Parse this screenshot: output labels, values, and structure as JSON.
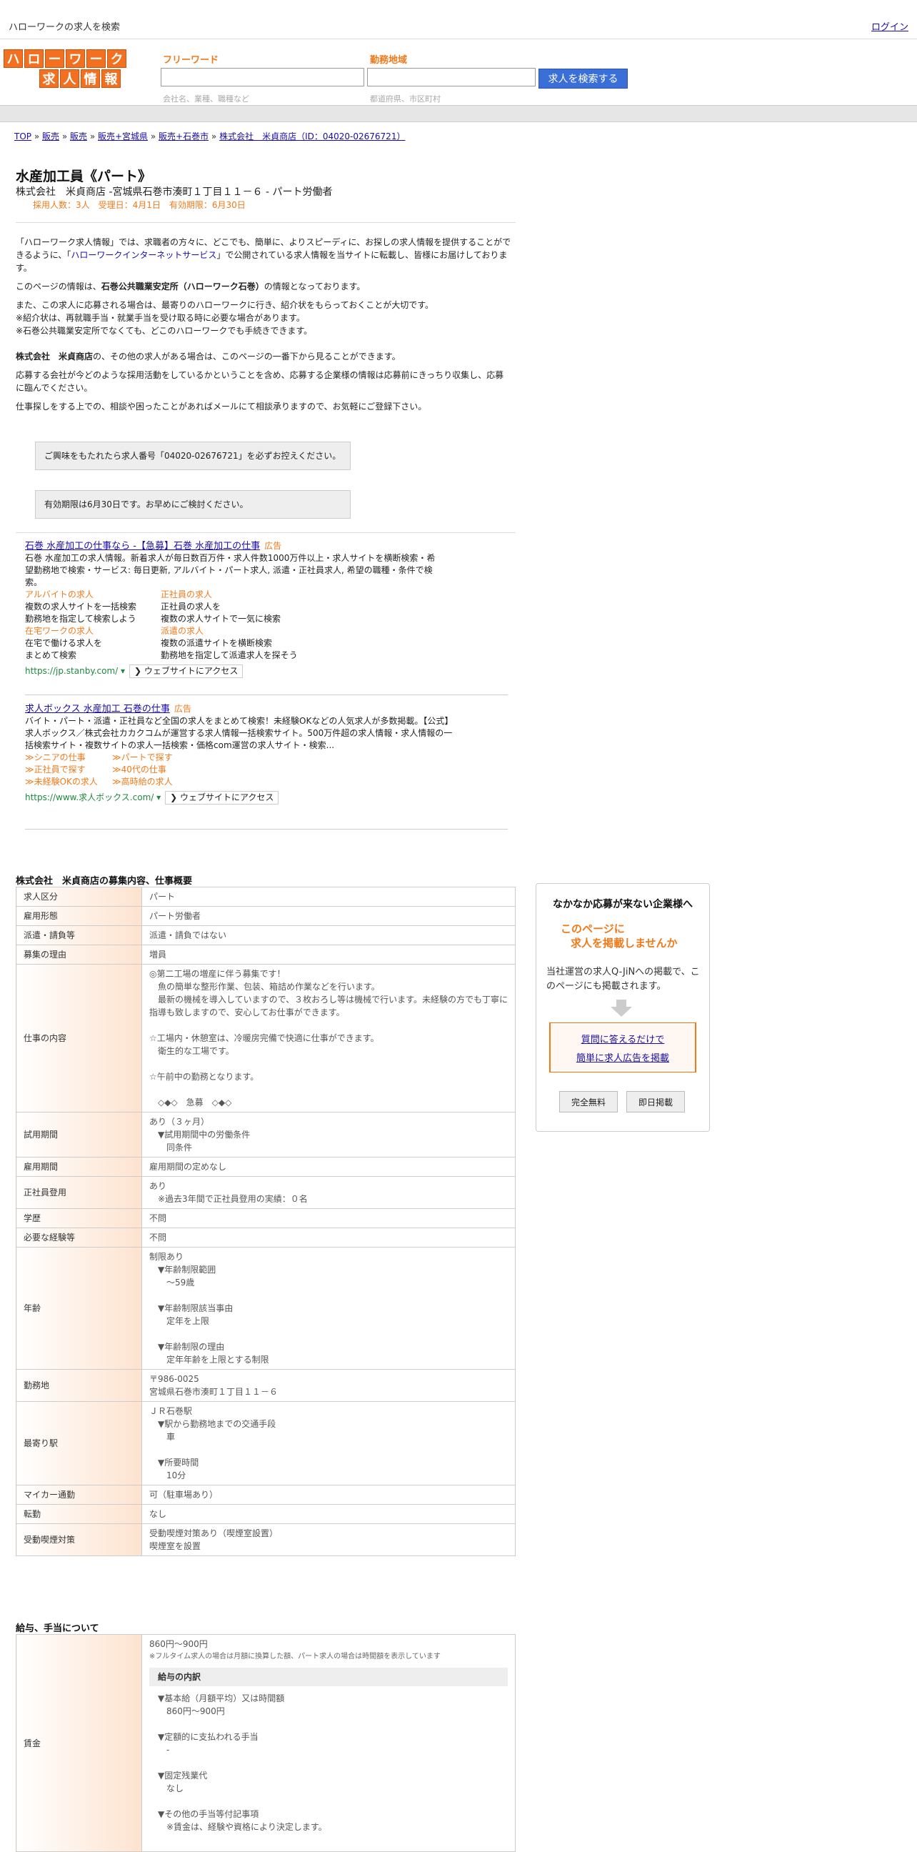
{
  "header": {
    "site_title": "ハローワークの求人を検索",
    "login": "ログイン"
  },
  "search": {
    "logo_row1": [
      "ハ",
      "ロ",
      "ー",
      "ワ",
      "ー",
      "ク"
    ],
    "logo_row2": [
      "求",
      "人",
      "情",
      "報"
    ],
    "keyword_label": "フリーワード",
    "keyword_placeholder": "会社名、業種、職種など",
    "area_label": "勤務地域",
    "area_placeholder": "都道府県、市区町村",
    "button": "求人を検索する"
  },
  "breadcrumb": [
    "TOP",
    "販売",
    "販売",
    "販売+宮城県",
    "販売+石巻市",
    "株式会社　米貞商店（ID：04020-02676721）"
  ],
  "job": {
    "title": "水産加工員《パート》",
    "company_line": "株式会社　米貞商店 -宮城県石巻市湊町１丁目１１－６ - パート労働者",
    "meta": "採用人数：3人　受理日：4月1日　有効期限：6月30日"
  },
  "intro": {
    "p1a": "「ハローワーク求人情報」では、求職者の方々に、どこでも、簡単に、よりスピーディに、お探しの求人情報を提供することができるように、「",
    "p1link": "ハローワークインターネットサービス",
    "p1b": "」で公開されている求人情報を当サイトに転載し、皆様にお届けしております。",
    "p2a": "このページの情報は、",
    "p2b": "石巻公共職業安定所（ハローワーク石巻）",
    "p2c": "の情報となっております。",
    "p3": "また、この求人に応募される場合は、最寄りのハローワークに行き、紹介状をもらっておくことが大切です。\n※紹介状は、再就職手当・就業手当を受け取る時に必要な場合があります。\n※石巻公共職業安定所でなくても、どこのハローワークでも手続きできます。",
    "p4a": "株式会社　米貞商店",
    "p4b": "の、その他の求人がある場合は、このページの一番下から見ることができます。",
    "p5": "応募する会社が今どのような採用活動をしているかということを含め、応募する企業様の情報は応募前にきっちり収集し、応募に臨んでください。",
    "p6": "仕事探しをする上での、相談や困ったことがあればメールにて相談承りますので、お気軽にご登録下さい。"
  },
  "notes": [
    "ご興味をもたれたら求人番号「04020-02676721」を必ずお控えください。",
    "有効期限は6月30日です。お早めにご検討ください。"
  ],
  "ads": [
    {
      "title": "石巻 水産加工の仕事なら -【急募】石巻 水産加工の仕事",
      "tag": "広告",
      "desc": "石巻 水産加工の求人情報。新着求人が毎日数百万件・求人件数1000万件以上・求人サイトを横断検索・希望勤務地で検索・サービス: 毎日更新, アルバイト・パート求人, 派遣・正社員求人, 希望の職種・条件で検索。",
      "links": [
        {
          "t": "アルバイトの求人",
          "d": "複数の求人サイトを一括検索\n勤務地を指定して検索しよう"
        },
        {
          "t": "正社員の求人",
          "d": "正社員の求人を\n複数の求人サイトで一気に検索"
        },
        {
          "t": "在宅ワークの求人",
          "d": "在宅で働ける求人を\nまとめて検索"
        },
        {
          "t": "派遣の求人",
          "d": "複数の派遣サイトを横断検索\n勤務地を指定して派遣求人を探そう"
        }
      ],
      "url": "https://jp.stanby.com/",
      "visit": "❯ ウェブサイトにアクセス"
    },
    {
      "title": "求人ボックス 水産加工 石巻の仕事",
      "tag": "広告",
      "desc": "バイト・パート・派遣・正社員など全国の求人をまとめて検索！未経験OKなどの人気求人が多数掲載。【公式】求人ボックス／株式会社カカクコムが運営する求人情報一括検索サイト。500万件超の求人情報・求人情報の一括検索サイト・複数サイトの求人一括検索・価格com運営の求人サイト・検索...",
      "links": [
        {
          "t": "≫シニアの仕事"
        },
        {
          "t": "≫パートで探す"
        },
        {
          "t": "≫正社員で探す"
        },
        {
          "t": "≫40代の仕事"
        },
        {
          "t": "≫未経験OKの求人"
        },
        {
          "t": "≫高時給の求人"
        }
      ],
      "url": "https://www.求人ボックス.com/",
      "visit": "❯ ウェブサイトにアクセス"
    }
  ],
  "details_title": "株式会社　米貞商店の募集内容、仕事概要",
  "details": [
    {
      "k": "求人区分",
      "v": "パート"
    },
    {
      "k": "雇用形態",
      "v": "パート労働者"
    },
    {
      "k": "派遣・請負等",
      "v": "派遣・請負ではない"
    },
    {
      "k": "募集の理由",
      "v": "増員"
    },
    {
      "k": "仕事の内容",
      "v": "◎第二工場の増産に伴う募集です！\n　魚の簡単な整形作業、包装、箱詰め作業などを行います。\n　最新の機械を導入していますので、３枚おろし等は機械で行います。未経験の方でも丁寧に指導も致しますので、安心してお仕事ができます。\n\n☆工場内・休憩室は、冷暖房完備で快適に仕事ができます。\n　衛生的な工場です。\n\n☆午前中の勤務となります。\n\n　◇◆◇　急募　◇◆◇"
    },
    {
      "k": "試用期間",
      "v": "あり（３ヶ月）\n　▼試用期間中の労働条件\n　　同条件"
    },
    {
      "k": "雇用期間",
      "v": "雇用期間の定めなし"
    },
    {
      "k": "正社員登用",
      "v": "あり\n　※過去3年間で正社員登用の実績：０名"
    },
    {
      "k": "学歴",
      "v": "不問"
    },
    {
      "k": "必要な経験等",
      "v": "不問"
    },
    {
      "k": "年齢",
      "v": "制限あり\n　▼年齢制限範囲\n　　〜59歳\n\n　▼年齢制限該当事由\n　　定年を上限\n\n　▼年齢制限の理由\n　　定年年齢を上限とする制限"
    },
    {
      "k": "勤務地",
      "v": "〒986-0025\n宮城県石巻市湊町１丁目１１－６"
    },
    {
      "k": "最寄り駅",
      "v": "ＪＲ石巻駅\n　▼駅から勤務地までの交通手段\n　　車\n\n　▼所要時間\n　　10分"
    },
    {
      "k": "マイカー通勤",
      "v": "可（駐車場あり）"
    },
    {
      "k": "転勤",
      "v": "なし"
    },
    {
      "k": "受動喫煙対策",
      "v": "受動喫煙対策あり（喫煙室設置）\n喫煙室を設置"
    }
  ],
  "salary_title": "給与、手当について",
  "salary": {
    "k": "賃金",
    "range": "860円〜900円",
    "note": "※フルタイム求人の場合は月額に換算した額、パート求人の場合は時間額を表示しています",
    "sub": "給与の内訳",
    "items": "▼基本給（月額平均）又は時間額\n　860円〜900円\n\n▼定額的に支払われる手当\n　-\n\n▼固定残業代\n　なし\n\n▼その他の手当等付記事項\n　※賃金は、経験や資格により決定します。"
  },
  "sidebar": {
    "heading": "なかなか応募が来ない企業様へ",
    "line1": "このページに",
    "line2": "求人を掲載しませんか",
    "desc": "当社運営の求人Q-JiNへの掲載で、このページにも掲載されます。",
    "link1": "質問に答えるだけで",
    "link2": "簡単に求人広告を掲載",
    "btn1": "完全無料",
    "btn2": "即日掲載"
  },
  "colors": {
    "accent": "#f07a1a",
    "button": "#3b6fd8",
    "link": "#1a0dab",
    "ad_url": "#1e8a3e"
  }
}
